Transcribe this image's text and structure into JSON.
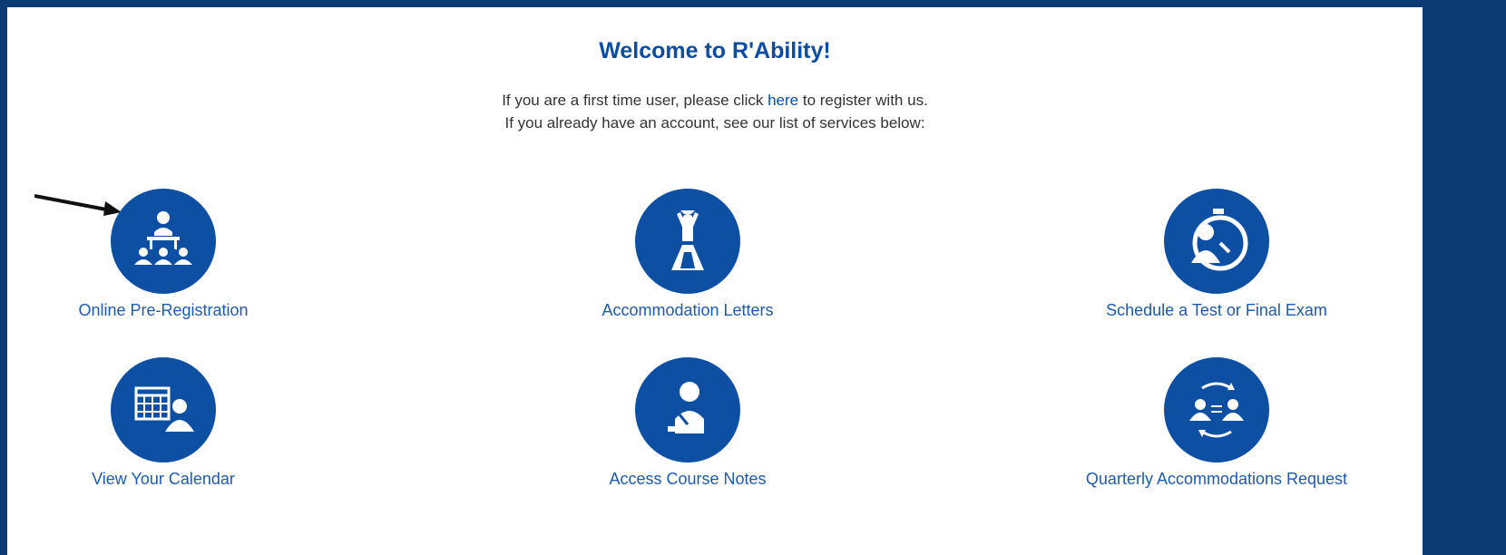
{
  "header": {
    "title": "Welcome to R'Ability!"
  },
  "intro": {
    "line1_before": "If you are a first time user, please click ",
    "line1_link": "here",
    "line1_after": " to register with us.",
    "line2": "If you already have an account, see our list of services below:"
  },
  "services": [
    {
      "label": "Online Pre-Registration",
      "icon": "classroom-icon"
    },
    {
      "label": "Accommodation Letters",
      "icon": "graduate-podium-icon"
    },
    {
      "label": "Schedule a Test or Final Exam",
      "icon": "stopwatch-person-icon"
    },
    {
      "label": "View Your Calendar",
      "icon": "calendar-person-icon"
    },
    {
      "label": "Access Course Notes",
      "icon": "person-writing-icon"
    },
    {
      "label": "Quarterly Accommodations Request",
      "icon": "exchange-people-icon"
    }
  ],
  "colors": {
    "frame": "#0c3a72",
    "accent": "#0d4fa3",
    "link": "#1f5aa8"
  }
}
